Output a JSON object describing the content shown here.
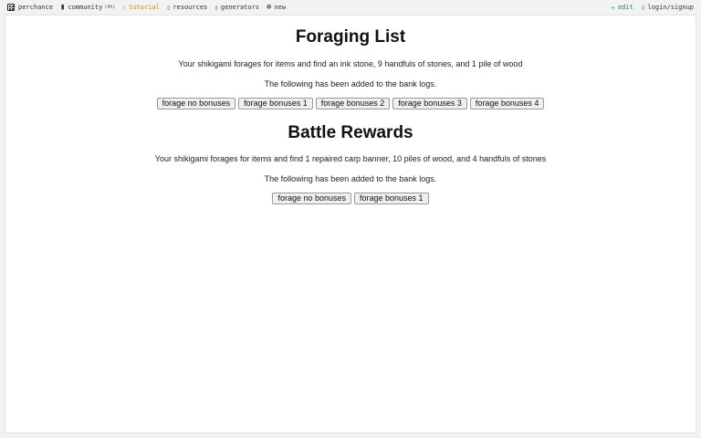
{
  "nav": {
    "brand": "perchance",
    "community": "community",
    "community_suffix": "(4h)",
    "tutorial": "tutorial",
    "resources": "resources",
    "generators": "generators",
    "new": "new",
    "edit": "edit",
    "login": "login/signup"
  },
  "icons": {
    "brand": "dice-icon",
    "community": "chat-icon",
    "tutorial": "book-icon",
    "resources": "folder-icon",
    "generators": "list-icon",
    "new": "plus-circle-icon",
    "edit": "pencil-icon",
    "login": "user-icon"
  },
  "colors": {
    "tutorial": "#d78a1b",
    "edit": "#2d8a3a"
  },
  "foraging": {
    "title": "Foraging List",
    "result": "Your shikigami forages for items and find an ink stone, 9 handfuls of stones, and 1 pile of wood",
    "note": "The following has been added to the bank logs.",
    "buttons": [
      "forage no bonuses",
      "forage bonuses 1",
      "forage bonuses 2",
      "forage bonuses 3",
      "forage bonuses 4"
    ]
  },
  "battle": {
    "title": "Battle Rewards",
    "result": "Your shikigami forages for items and find 1 repaired carp banner, 10 piles of wood, and 4 handfuls of stones",
    "note": "The following has been added to the bank logs.",
    "buttons": [
      "forage no bonuses",
      "forage bonuses 1"
    ]
  }
}
